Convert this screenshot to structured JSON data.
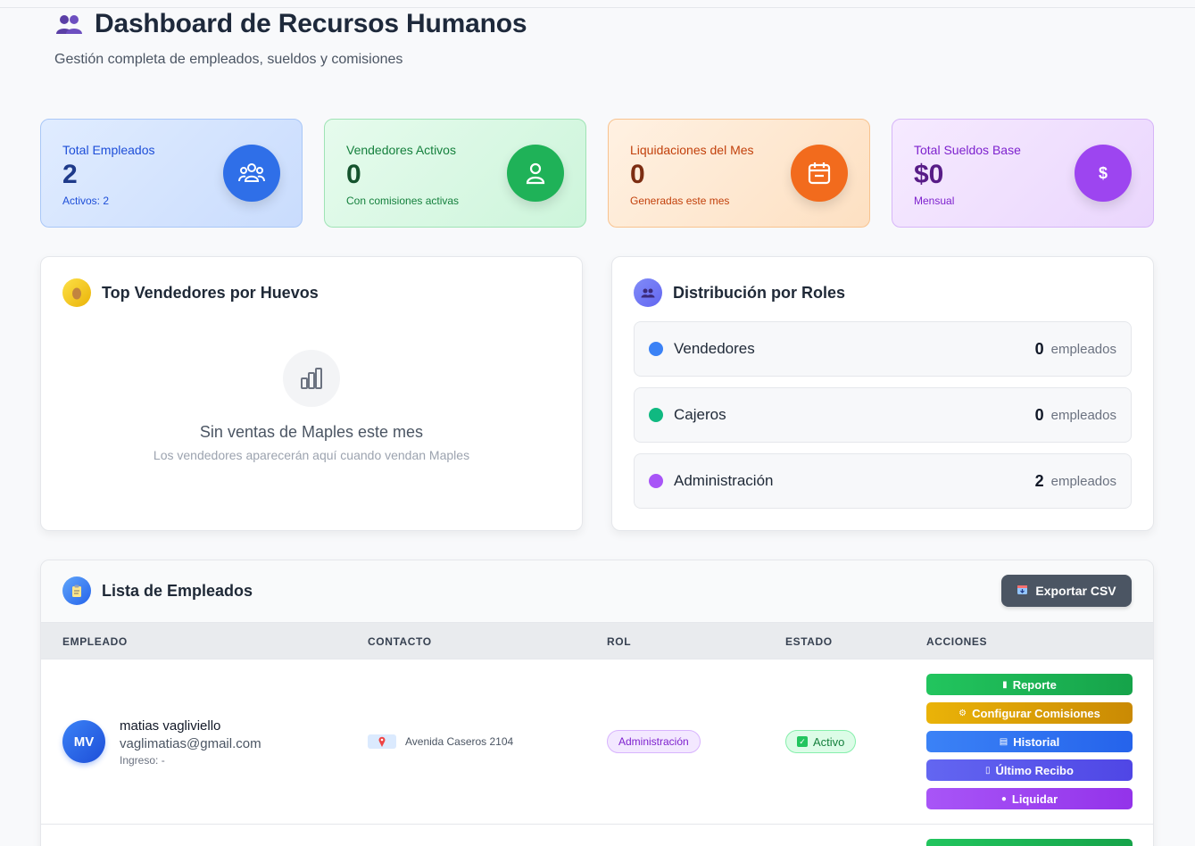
{
  "header": {
    "title": "Dashboard de Recursos Humanos",
    "subtitle": "Gestión completa de empleados, sueldos y comisiones"
  },
  "stats": [
    {
      "label": "Total Empleados",
      "value": "2",
      "sub": "Activos: 2",
      "icon": "users-icon",
      "color": "#2f6fe8"
    },
    {
      "label": "Vendedores Activos",
      "value": "0",
      "sub": "Con comisiones activas",
      "icon": "user-icon",
      "color": "#1fb258"
    },
    {
      "label": "Liquidaciones del Mes",
      "value": "0",
      "sub": "Generadas este mes",
      "icon": "calendar-icon",
      "color": "#f26b1d"
    },
    {
      "label": "Total Sueldos Base",
      "value": "$0",
      "sub": "Mensual",
      "icon": "dollar-icon",
      "color": "#9d45f0"
    }
  ],
  "top_sellers": {
    "title": "Top Vendedores por Huevos",
    "empty_title": "Sin ventas de Maples este mes",
    "empty_sub": "Los vendedores aparecerán aquí cuando vendan Maples"
  },
  "roles": {
    "title": "Distribución por Roles",
    "unit": "empleados",
    "items": [
      {
        "name": "Vendedores",
        "count": "0",
        "color": "#3b82f6"
      },
      {
        "name": "Cajeros",
        "count": "0",
        "color": "#10b981"
      },
      {
        "name": "Administración",
        "count": "2",
        "color": "#a855f7"
      }
    ]
  },
  "employees": {
    "title": "Lista de Empleados",
    "export_label": "Exportar CSV",
    "columns": [
      "EMPLEADO",
      "CONTACTO",
      "ROL",
      "ESTADO",
      "ACCIONES"
    ],
    "rows": [
      {
        "initials": "MV",
        "name": "matias vagliviello",
        "email": "vaglimatias@gmail.com",
        "ingreso": "Ingreso: -",
        "address": "Avenida Caseros 2104",
        "role": "Administración",
        "status": "Activo",
        "actions": [
          "Reporte",
          "Configurar Comisiones",
          "Historial",
          "Último Recibo",
          "Liquidar"
        ]
      }
    ]
  }
}
